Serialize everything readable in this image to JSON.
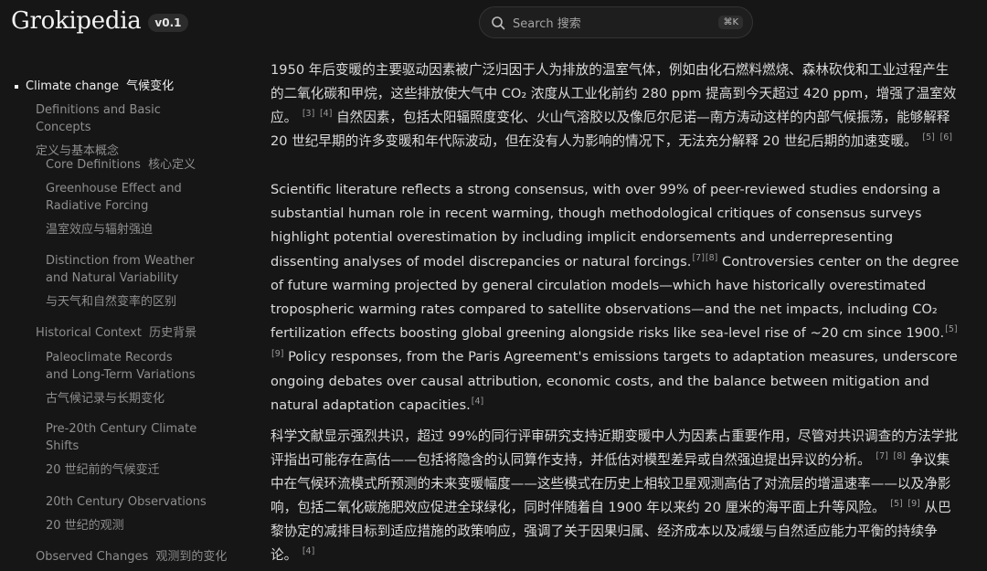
{
  "header": {
    "brand": "Grokipedia",
    "version": "v0.1",
    "search_placeholder": "Search  搜索",
    "shortcut": "⌘K"
  },
  "sidebar": {
    "items": [
      {
        "label": "Climate change",
        "zh": "气候变化"
      },
      {
        "label": "Definitions and Basic Concepts",
        "zh": "定义与基本概念"
      },
      {
        "label": "Core Definitions",
        "zh": "核心定义"
      },
      {
        "label": "Greenhouse Effect and Radiative Forcing",
        "zh": "温室效应与辐射强迫"
      },
      {
        "label": "Distinction from Weather and Natural Variability",
        "zh": "与天气和自然变率的区别"
      },
      {
        "label": "Historical Context",
        "zh": "历史背景"
      },
      {
        "label": "Paleoclimate Records and Long-Term Variations",
        "zh": "古气候记录与长期变化"
      },
      {
        "label": "Pre-20th Century Climate Shifts",
        "zh": "20 世纪前的气候变迁"
      },
      {
        "label": "20th Century Observations",
        "zh": "20 世纪的观测"
      },
      {
        "label": "Observed Changes",
        "zh": "观测到的变化"
      }
    ]
  },
  "article": {
    "p1_zh": {
      "a": "1950 年后变暖的主要驱动因素被广泛归因于人为排放的温室气体，例如由化石燃料燃烧、森林砍伐和工业过程产生的二氧化碳和甲烷，这些排放使大气中 CO₂ 浓度从工业化前约 280 ppm 提高到今天超过 420 ppm，增强了温室效应。",
      "r1": "[3]",
      "r2": "[4]",
      "b": " 自然因素，包括太阳辐照度变化、火山气溶胶以及像厄尔尼诺—南方涛动这样的内部气候振荡，能够解释 20 世纪早期的许多变暖和年代际波动，但在没有人为影响的情况下，无法充分解释 20 世纪后期的加速变暖。",
      "r3": "[5]",
      "r4": "[6]"
    },
    "p2_en": {
      "a": "Scientific literature reflects a strong consensus, with over 99% of peer-reviewed studies endorsing a substantial human role in recent warming, though methodological critiques of consensus surveys highlight potential overestimation by including implicit endorsements and underrepresenting dissenting analyses of model discrepancies or natural forcings.",
      "r1": "[7]",
      "r2": "[8]",
      "b": " Controversies center on the degree of future warming projected by general circulation models—which have historically overestimated tropospheric warming rates compared to satellite observations—and the net impacts, including CO₂ fertilization effects boosting global greening alongside risks like sea-level rise of ~20 cm since 1900.",
      "r3": "[5]",
      "r4": "[9]",
      "c": " Policy responses, from the Paris Agreement's emissions targets to adaptation measures, underscore ongoing debates over causal attribution, economic costs, and the balance between mitigation and natural adaptation capacities.",
      "r5": "[4]"
    },
    "p3_zh": {
      "a": "科学文献显示强烈共识，超过 99%的同行评审研究支持近期变暖中人为因素占重要作用，尽管对共识调查的方法学批评指出可能存在高估——包括将隐含的认同算作支持，并低估对模型差异或自然强迫提出异议的分析。",
      "r1": "[7]",
      "r2": "[8]",
      "b": " 争议集中在气候环流模式所预测的未来变暖幅度——这些模式在历史上相较卫星观测高估了对流层的增温速率——以及净影响，包括二氧化碳施肥效应促进全球绿化，同时伴随着自 1900 年以来约 20 厘米的海平面上升等风险。",
      "r3": "[5]",
      "r4": "[9]",
      "c": " 从巴黎协定的减排目标到适应措施的政策响应，强调了关于因果归属、经济成本以及减缓与自然适应能力平衡的持续争论。",
      "r5": "[4]"
    }
  }
}
